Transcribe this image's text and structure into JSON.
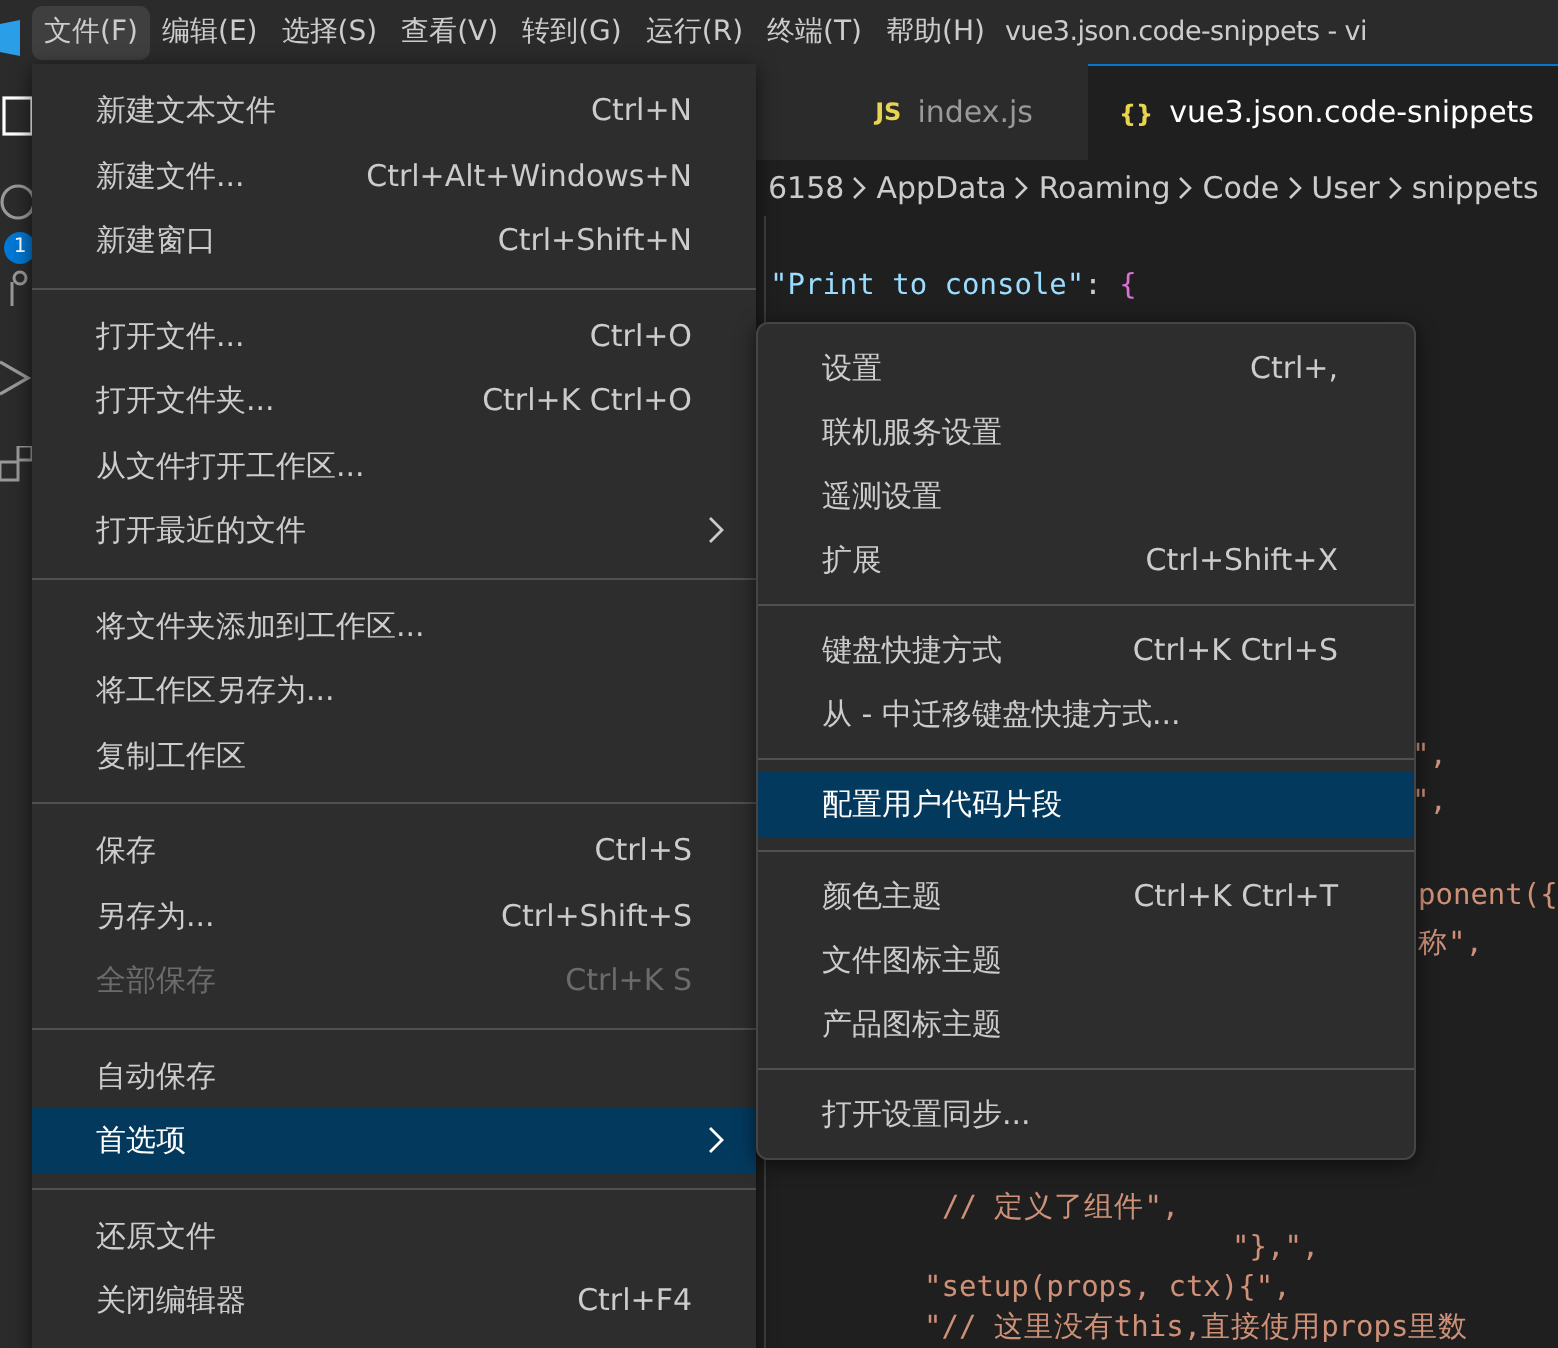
{
  "menu_bar": {
    "items": [
      {
        "label": "文件(F)",
        "selected": true
      },
      {
        "label": "编辑(E)",
        "selected": false
      },
      {
        "label": "选择(S)",
        "selected": false
      },
      {
        "label": "查看(V)",
        "selected": false
      },
      {
        "label": "转到(G)",
        "selected": false
      },
      {
        "label": "运行(R)",
        "selected": false
      },
      {
        "label": "终端(T)",
        "selected": false
      },
      {
        "label": "帮助(H)",
        "selected": false
      }
    ],
    "window_title": "vue3.json.code-snippets - vi"
  },
  "activity_bar": {
    "badge": "1"
  },
  "tabs": [
    {
      "label": "index.js",
      "icon": "JS",
      "selected": false
    },
    {
      "label": "vue3.json.code-snippets",
      "icon": "{}",
      "selected": true
    }
  ],
  "breadcrumb": [
    "6158",
    "AppData",
    "Roaming",
    "Code",
    "User",
    "snippets"
  ],
  "code_lines": [
    {
      "parts": [
        {
          "text": "\"Print to console\"",
          "kind": "key"
        },
        {
          "text": ": ",
          "kind": "punct"
        },
        {
          "text": "{",
          "kind": "brace"
        }
      ]
    },
    {
      "parts": [
        {
          "text": "\",",
          "kind": "string"
        }
      ]
    },
    {
      "parts": [
        {
          "text": "\",",
          "kind": "string"
        }
      ]
    },
    {
      "parts": [
        {
          "text": "ponent({",
          "kind": "string"
        }
      ]
    },
    {
      "parts": [
        {
          "text": "称\",",
          "kind": "string"
        }
      ]
    },
    {
      "parts": [
        {
          "text": "// 定义了组件\",",
          "kind": "string"
        }
      ]
    },
    {
      "parts": [
        {
          "text": "\"},\",",
          "kind": "string"
        }
      ]
    },
    {
      "parts": [
        {
          "text": "\"setup(props, ctx){\",",
          "kind": "string"
        }
      ]
    },
    {
      "parts": [
        {
          "text": "\"// 这里没有this,直接使用props里数",
          "kind": "string"
        }
      ]
    }
  ],
  "file_menu": [
    {
      "kind": "item",
      "label": "新建文本文件",
      "shortcut": "Ctrl+N"
    },
    {
      "kind": "item",
      "label": "新建文件...",
      "shortcut": "Ctrl+Alt+Windows+N"
    },
    {
      "kind": "item",
      "label": "新建窗口",
      "shortcut": "Ctrl+Shift+N"
    },
    {
      "kind": "separator"
    },
    {
      "kind": "item",
      "label": "打开文件...",
      "shortcut": "Ctrl+O"
    },
    {
      "kind": "item",
      "label": "打开文件夹...",
      "shortcut": "Ctrl+K Ctrl+O"
    },
    {
      "kind": "item",
      "label": "从文件打开工作区..."
    },
    {
      "kind": "submenu",
      "label": "打开最近的文件",
      "selected": false
    },
    {
      "kind": "separator"
    },
    {
      "kind": "item",
      "label": "将文件夹添加到工作区..."
    },
    {
      "kind": "item",
      "label": "将工作区另存为..."
    },
    {
      "kind": "item",
      "label": "复制工作区"
    },
    {
      "kind": "separator"
    },
    {
      "kind": "item",
      "label": "保存",
      "shortcut": "Ctrl+S"
    },
    {
      "kind": "item",
      "label": "另存为...",
      "shortcut": "Ctrl+Shift+S"
    },
    {
      "kind": "item",
      "label": "全部保存",
      "shortcut": "Ctrl+K S",
      "disabled": true
    },
    {
      "kind": "separator"
    },
    {
      "kind": "item",
      "label": "自动保存"
    },
    {
      "kind": "submenu",
      "label": "首选项",
      "selected": true
    },
    {
      "kind": "separator"
    },
    {
      "kind": "item",
      "label": "还原文件"
    },
    {
      "kind": "item",
      "label": "关闭编辑器",
      "shortcut": "Ctrl+F4"
    }
  ],
  "preferences_menu": [
    {
      "kind": "item",
      "label": "设置",
      "shortcut": "Ctrl+,",
      "selected": false
    },
    {
      "kind": "item",
      "label": "联机服务设置",
      "selected": false
    },
    {
      "kind": "item",
      "label": "遥测设置",
      "selected": false
    },
    {
      "kind": "item",
      "label": "扩展",
      "shortcut": "Ctrl+Shift+X",
      "selected": false
    },
    {
      "kind": "separator"
    },
    {
      "kind": "item",
      "label": "键盘快捷方式",
      "shortcut": "Ctrl+K Ctrl+S",
      "selected": false
    },
    {
      "kind": "item",
      "label": "从 - 中迁移键盘快捷方式...",
      "selected": false
    },
    {
      "kind": "separator"
    },
    {
      "kind": "item",
      "label": "配置用户代码片段",
      "selected": true
    },
    {
      "kind": "separator"
    },
    {
      "kind": "item",
      "label": "颜色主题",
      "shortcut": "Ctrl+K Ctrl+T",
      "selected": false
    },
    {
      "kind": "item",
      "label": "文件图标主题",
      "selected": false
    },
    {
      "kind": "item",
      "label": "产品图标主题",
      "selected": false
    },
    {
      "kind": "separator"
    },
    {
      "kind": "item",
      "label": "打开设置同步...",
      "selected": false
    }
  ]
}
